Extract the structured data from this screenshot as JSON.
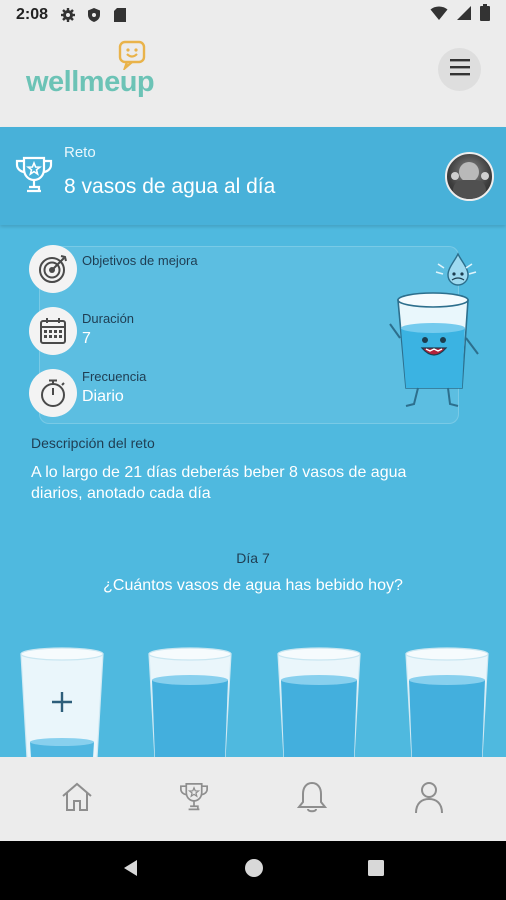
{
  "status_bar": {
    "time": "2:08"
  },
  "header": {
    "logo_text": "wellmeup"
  },
  "challenge": {
    "label": "Reto",
    "title": "8 vasos de agua al día"
  },
  "info": {
    "objetivos_label": "Objetivos de mejora",
    "duracion_label": "Duración",
    "duracion_value": "7",
    "frecuencia_label": "Frecuencia",
    "frecuencia_value": "Diario"
  },
  "description": {
    "label": "Descripción del reto",
    "text": "A lo largo de 21 días deberás beber 8 vasos de agua diarios, anotado cada día"
  },
  "tracker": {
    "day_label": "Día 7",
    "question": "¿Cuántos vasos de agua has bebido hoy?",
    "glasses": [
      {
        "state": "empty",
        "fill": 0.12
      },
      {
        "state": "full",
        "fill": 0.82
      },
      {
        "state": "full",
        "fill": 0.82
      },
      {
        "state": "full",
        "fill": 0.82
      }
    ]
  },
  "bottom_nav": [
    "home-icon",
    "trophy-icon",
    "bell-icon",
    "user-icon"
  ],
  "colors": {
    "accent": "#4fb9df",
    "header": "#48b1d9",
    "logo": "#6cc3b6",
    "nav": "#ececec"
  }
}
